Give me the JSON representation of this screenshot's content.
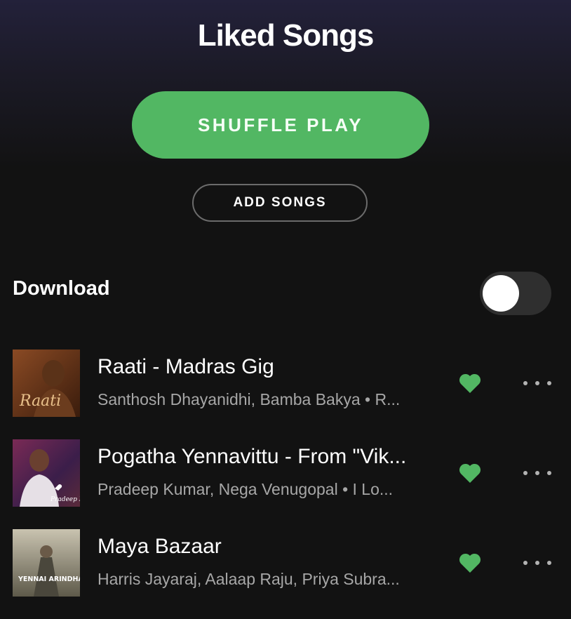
{
  "header": {
    "title": "Liked Songs"
  },
  "actions": {
    "shuffle_label": "SHUFFLE PLAY",
    "add_label": "ADD SONGS"
  },
  "download": {
    "label": "Download",
    "enabled": false
  },
  "colors": {
    "accent": "#52b763",
    "background": "#121212",
    "secondary_text": "#a7a7a7"
  },
  "tracks": [
    {
      "title": "Raati - Madras Gig",
      "subtitle": "Santhosh Dhayanidhi, Bamba Bakya • R...",
      "liked": true,
      "art_text": "Raati"
    },
    {
      "title": "Pogatha Yennavittu - From \"Vik...",
      "subtitle": "Pradeep Kumar, Nega Venugopal • I Lo...",
      "liked": true,
      "art_text": "Pradeep Kumar"
    },
    {
      "title": "Maya Bazaar",
      "subtitle": "Harris Jayaraj, Aalaap Raju, Priya Subra...",
      "liked": true,
      "art_text": "YENNAI ARINDHAAL"
    }
  ]
}
